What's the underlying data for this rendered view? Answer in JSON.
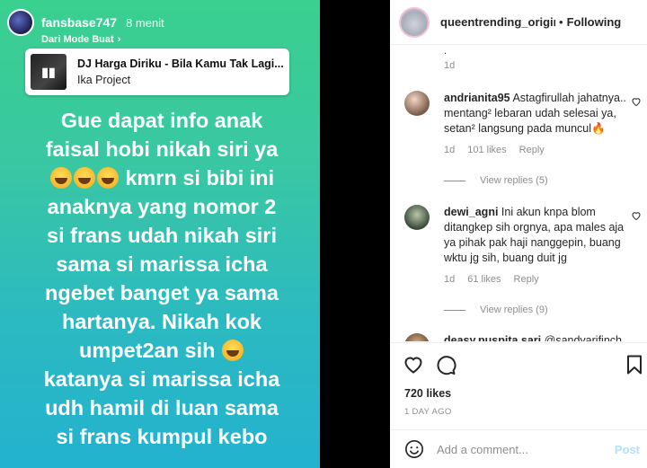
{
  "story": {
    "username": "fansbase747",
    "time": "8 menit",
    "subtitle": "Dari Mode Buat",
    "music": {
      "title": "DJ Harga Diriku - Bila Kamu Tak Lagi...",
      "artist": "Ika Project"
    },
    "lines": [
      "Gue dapat info anak",
      "faisal hobi nikah siri ya",
      "kmrn si bibi ini",
      "anaknya  yang nomor 2",
      "si frans udah nikah siri",
      "sama si marissa icha",
      "ngebet banget ya sama",
      "hartanya. Nikah kok",
      "umpet2an sih",
      "katanya si marissa icha",
      "udh hamil di luan sama",
      "si frans kumpul kebo"
    ]
  },
  "post": {
    "username": "queentrending_origina",
    "follow_label": "Following",
    "top_time": "1d",
    "comments": [
      {
        "user": "andrianita95",
        "text": "Astagfirullah jahatnya.. mentang² lebaran udah selesai ya, setan² langsung pada muncul🔥",
        "time": "1d",
        "likes": "101 likes",
        "reply": "Reply",
        "view_replies": "View replies (5)"
      },
      {
        "user": "dewi_agni",
        "text": "Ini akun knpa blom ditangkep sih orgnya, apa males aja ya pihak pak haji nanggepin, buang wktu jg sih, buang duit jg",
        "time": "1d",
        "likes": "61 likes",
        "reply": "Reply",
        "view_replies": "View replies (9)"
      },
      {
        "user": "deasy.puspita.sari",
        "text": "@sandyarifinch"
      }
    ],
    "likes": "720 likes",
    "date": "1 DAY AGO",
    "comment_placeholder": "Add a comment...",
    "post_label": "Post"
  }
}
